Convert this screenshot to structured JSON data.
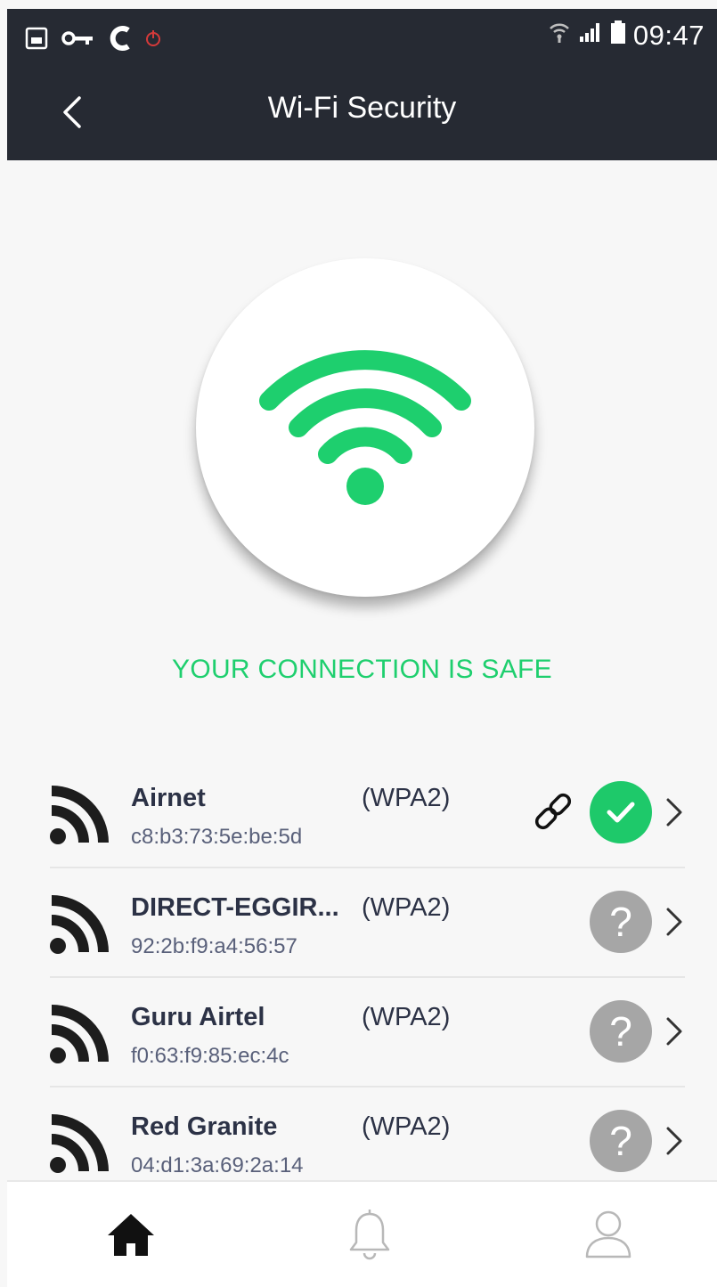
{
  "status_bar": {
    "time": "09:47",
    "left_icons": [
      "gallery-icon",
      "vpn-key-icon",
      "c-app-icon",
      "power-alert-icon"
    ],
    "right_icons": [
      "wifi-signal-icon",
      "cell-signal-icon",
      "battery-icon"
    ]
  },
  "header": {
    "title": "Wi-Fi Security",
    "back_icon": "chevron-left-icon"
  },
  "hero": {
    "icon": "wifi-icon",
    "message": "YOUR CONNECTION IS SAFE"
  },
  "networks": [
    {
      "name": "Airnet",
      "security": "(WPA2)",
      "mac": "c8:b3:73:5e:be:5d",
      "connected": true,
      "status": "safe"
    },
    {
      "name": "DIRECT-EGGIR...",
      "security": "(WPA2)",
      "mac": "92:2b:f9:a4:56:57",
      "connected": false,
      "status": "unknown",
      "status_glyph": "?"
    },
    {
      "name": "Guru Airtel",
      "security": "(WPA2)",
      "mac": "f0:63:f9:85:ec:4c",
      "connected": false,
      "status": "unknown",
      "status_glyph": "?"
    },
    {
      "name": "Red Granite",
      "security": "(WPA2)",
      "mac": "04:d1:3a:69:2a:14",
      "connected": false,
      "status": "unknown",
      "status_glyph": "?"
    }
  ],
  "bottom_nav": {
    "items": [
      "home-icon",
      "bell-icon",
      "profile-icon"
    ],
    "active": "home-icon"
  },
  "colors": {
    "header_bg": "#262a33",
    "accent_green": "#1ecf6e",
    "unknown_gray": "#a6a6a6",
    "text_dark": "#2c3246"
  }
}
